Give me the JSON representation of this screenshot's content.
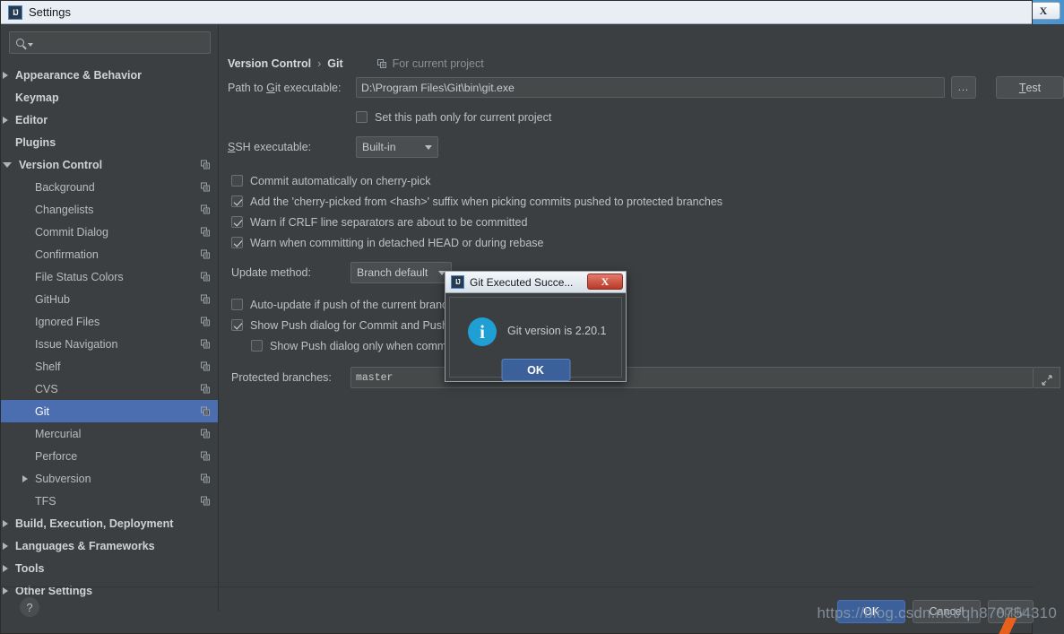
{
  "window": {
    "title": "Settings",
    "logo_text": "IJ",
    "close_label": "X"
  },
  "search": {
    "placeholder": "",
    "value": "",
    "icon": "search-icon"
  },
  "sidebar": {
    "items": [
      {
        "label": "Appearance & Behavior",
        "level": 0,
        "bold": true,
        "arrow": "right",
        "copy": false,
        "selected": false
      },
      {
        "label": "Keymap",
        "level": 0,
        "bold": true,
        "arrow": "none",
        "copy": false,
        "selected": false
      },
      {
        "label": "Editor",
        "level": 0,
        "bold": true,
        "arrow": "right",
        "copy": false,
        "selected": false
      },
      {
        "label": "Plugins",
        "level": 0,
        "bold": true,
        "arrow": "none",
        "copy": false,
        "selected": false
      },
      {
        "label": "Version Control",
        "level": 0,
        "bold": true,
        "arrow": "down",
        "copy": true,
        "selected": false
      },
      {
        "label": "Background",
        "level": 1,
        "bold": false,
        "arrow": "none",
        "copy": true,
        "selected": false
      },
      {
        "label": "Changelists",
        "level": 1,
        "bold": false,
        "arrow": "none",
        "copy": true,
        "selected": false
      },
      {
        "label": "Commit Dialog",
        "level": 1,
        "bold": false,
        "arrow": "none",
        "copy": true,
        "selected": false
      },
      {
        "label": "Confirmation",
        "level": 1,
        "bold": false,
        "arrow": "none",
        "copy": true,
        "selected": false
      },
      {
        "label": "File Status Colors",
        "level": 1,
        "bold": false,
        "arrow": "none",
        "copy": true,
        "selected": false
      },
      {
        "label": "GitHub",
        "level": 1,
        "bold": false,
        "arrow": "none",
        "copy": true,
        "selected": false
      },
      {
        "label": "Ignored Files",
        "level": 1,
        "bold": false,
        "arrow": "none",
        "copy": true,
        "selected": false
      },
      {
        "label": "Issue Navigation",
        "level": 1,
        "bold": false,
        "arrow": "none",
        "copy": true,
        "selected": false
      },
      {
        "label": "Shelf",
        "level": 1,
        "bold": false,
        "arrow": "none",
        "copy": true,
        "selected": false
      },
      {
        "label": "CVS",
        "level": 1,
        "bold": false,
        "arrow": "none",
        "copy": true,
        "selected": false
      },
      {
        "label": "Git",
        "level": 1,
        "bold": false,
        "arrow": "none",
        "copy": true,
        "selected": true
      },
      {
        "label": "Mercurial",
        "level": 1,
        "bold": false,
        "arrow": "none",
        "copy": true,
        "selected": false
      },
      {
        "label": "Perforce",
        "level": 1,
        "bold": false,
        "arrow": "none",
        "copy": true,
        "selected": false
      },
      {
        "label": "Subversion",
        "level": 1,
        "bold": false,
        "arrow": "right",
        "copy": true,
        "selected": false
      },
      {
        "label": "TFS",
        "level": 1,
        "bold": false,
        "arrow": "none",
        "copy": true,
        "selected": false
      },
      {
        "label": "Build, Execution, Deployment",
        "level": 0,
        "bold": true,
        "arrow": "right",
        "copy": false,
        "selected": false
      },
      {
        "label": "Languages & Frameworks",
        "level": 0,
        "bold": true,
        "arrow": "right",
        "copy": false,
        "selected": false
      },
      {
        "label": "Tools",
        "level": 0,
        "bold": true,
        "arrow": "right",
        "copy": false,
        "selected": false
      },
      {
        "label": "Other Settings",
        "level": 0,
        "bold": true,
        "arrow": "right",
        "copy": false,
        "selected": false
      }
    ]
  },
  "main": {
    "breadcrumb": {
      "parent": "Version Control",
      "separator": "›",
      "current": "Git"
    },
    "scope_note": "For current project",
    "git_path": {
      "label_pre": "Path to ",
      "label_key": "G",
      "label_post": "it executable:",
      "value": "D:\\Program Files\\Git\\bin\\git.exe",
      "browse_label": "...",
      "test_key": "T",
      "test_rest": "est"
    },
    "path_scope_checkbox": {
      "label": "Set this path only for current project",
      "checked": false
    },
    "ssh": {
      "label_key": "S",
      "label_rest": "SH executable:",
      "value": "Built-in"
    },
    "checkboxes": [
      {
        "label": "Commit automatically on cherry-pick",
        "checked": false,
        "indent": 0
      },
      {
        "label": "Add the 'cherry-picked from <hash>' suffix when picking commits pushed to protected branches",
        "checked": true,
        "indent": 0
      },
      {
        "label": "Warn if CRLF line separators are about to be committed",
        "checked": true,
        "indent": 0
      },
      {
        "label": "Warn when committing in detached HEAD or during rebase",
        "checked": true,
        "indent": 0
      }
    ],
    "update_method": {
      "label": "Update method:",
      "value": "Branch default"
    },
    "checkboxes2": [
      {
        "label": "Auto-update if push of the current branch was rejected",
        "checked": false,
        "indent": 0
      },
      {
        "label": "Show Push dialog for Commit and Push",
        "checked": true,
        "indent": 0
      },
      {
        "label": "Show Push dialog only when committing to a protected branch",
        "checked": false,
        "indent": 1
      }
    ],
    "protected_branches": {
      "label": "Protected branches:",
      "value": "master",
      "expand_icon": "expand-icon"
    }
  },
  "footer": {
    "help_label": "?",
    "ok_label": "OK",
    "cancel_label": "Cancel",
    "apply_label": "Apply",
    "watermark": "https://blog.csdn.net/qh870754310"
  },
  "dialog": {
    "title": "Git Executed Succe...",
    "logo_text": "IJ",
    "close_label": "X",
    "icon": "info-icon",
    "message": "Git version is 2.20.1",
    "ok_label": "OK"
  },
  "colors": {
    "accent_selection": "#4a6eb0",
    "panel_bg": "#3c3f41",
    "info_blue": "#1f9fd4",
    "dialog_close_red": "#b83a28",
    "watermark": "#8e9ba8"
  }
}
